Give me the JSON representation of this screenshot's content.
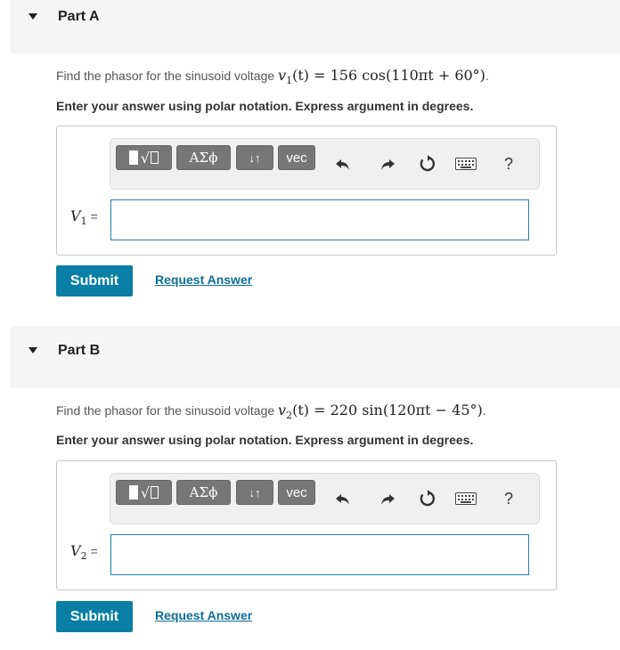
{
  "toolbar": {
    "greek_label": "ΑΣϕ",
    "arrows_label": "↓↑",
    "vec_label": "vec",
    "help_label": "?",
    "icons": [
      "template-icon",
      "undo-icon",
      "redo-icon",
      "reset-icon",
      "keyboard-icon",
      "help-icon"
    ]
  },
  "colors": {
    "submit_bg": "#0a7fa6",
    "link": "#0a6f99",
    "input_border": "#2a7fa0",
    "header_bg": "#f5f5f5"
  },
  "parts": [
    {
      "title": "Part A",
      "question_prefix": "Find the phasor for the sinusoid voltage ",
      "eq_var": "v",
      "eq_sub": "1",
      "eq_rhs": "(t) = 156 cos(110πt + 60°)",
      "eq_end": ".",
      "instruction": "Enter your answer using polar notation. Express argument in degrees.",
      "var_name": "V",
      "var_sub": "1",
      "var_eq": "=",
      "input_value": "",
      "submit_label": "Submit",
      "request_label": "Request Answer"
    },
    {
      "title": "Part B",
      "question_prefix": "Find the phasor for the sinusoid voltage ",
      "eq_var": "v",
      "eq_sub": "2",
      "eq_rhs": "(t) = 220 sin(120πt − 45°)",
      "eq_end": ".",
      "instruction": "Enter your answer using polar notation. Express argument in degrees.",
      "var_name": "V",
      "var_sub": "2",
      "var_eq": "=",
      "input_value": "",
      "submit_label": "Submit",
      "request_label": "Request Answer"
    }
  ]
}
